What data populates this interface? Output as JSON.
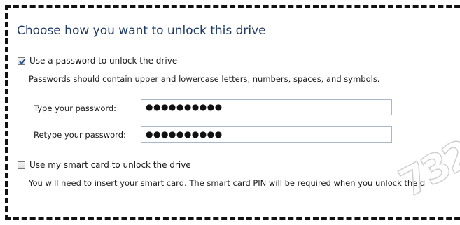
{
  "dialog": {
    "title": "Choose how you want to unlock this drive"
  },
  "password_option": {
    "label": "Use a password to unlock the drive",
    "checked": true,
    "description": "Passwords should contain upper and lowercase letters, numbers, spaces, and symbols.",
    "type_label": "Type your password:",
    "type_value": "●●●●●●●●●●",
    "retype_label": "Retype your password:",
    "retype_value": "●●●●●●●●●●"
  },
  "smartcard_option": {
    "label": "Use my smart card to unlock the drive",
    "checked": false,
    "description": "You will need to insert your smart card. The smart card PIN will be required when you unlock the d"
  },
  "watermark": {
    "text": "732"
  },
  "colors": {
    "title": "#1e3a66",
    "input_border": "#a9b7c9"
  },
  "icons": {
    "checked": "checkbox-checked-icon",
    "unchecked": "checkbox-unchecked-icon"
  }
}
